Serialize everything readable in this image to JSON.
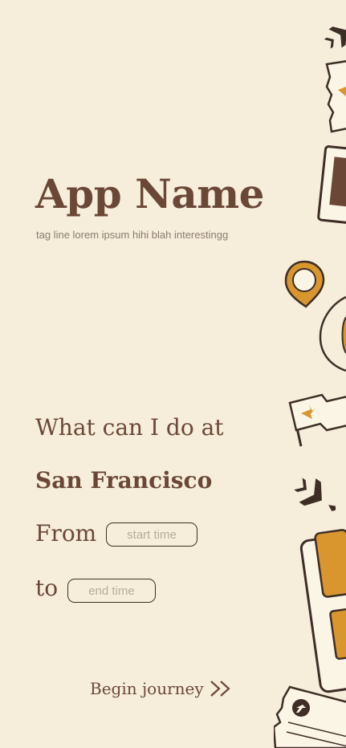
{
  "app": {
    "name": "App Name",
    "tagline": "tag line lorem ipsum hihi blah interestingg"
  },
  "query": {
    "line1": "What can I do at",
    "city": "San Francisco",
    "from_label": "From",
    "start_placeholder": "start time",
    "to_label": "to",
    "end_placeholder": "end time"
  },
  "cta": {
    "label": "Begin journey",
    "icon": "double-chevron-right-icon"
  },
  "colors": {
    "background": "#f6eedb",
    "text_brown": "#6b4737",
    "accent_orange": "#d9962f",
    "outline_dark": "#3e2e26"
  }
}
